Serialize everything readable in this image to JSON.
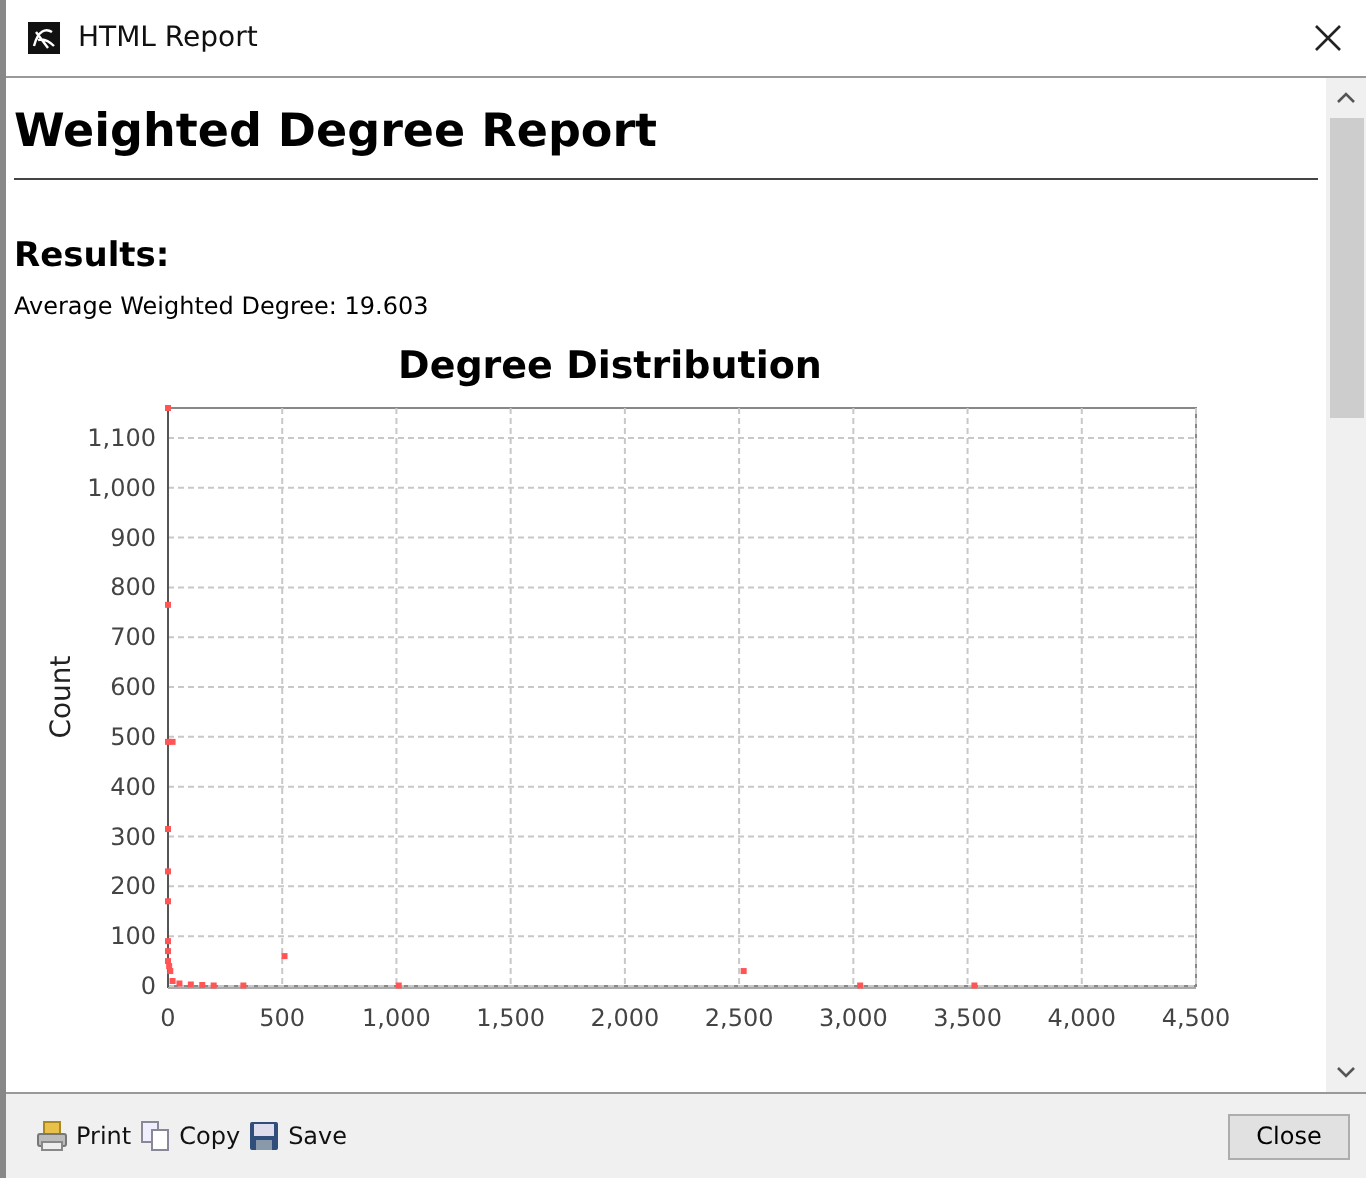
{
  "window": {
    "title": "HTML Report"
  },
  "report": {
    "heading": "Weighted Degree Report",
    "section": "Results:",
    "summary": "Average Weighted Degree: 19.603"
  },
  "chart_data": {
    "type": "scatter",
    "title": "Degree Distribution",
    "ylabel": "Count",
    "xlim": [
      0,
      4500
    ],
    "ylim": [
      0,
      1160
    ],
    "xticks": [
      {
        "value": 0,
        "label": "0"
      },
      {
        "value": 500,
        "label": "500"
      },
      {
        "value": 1000,
        "label": "1,000"
      },
      {
        "value": 1500,
        "label": "1,500"
      },
      {
        "value": 2000,
        "label": "2,000"
      },
      {
        "value": 2500,
        "label": "2,500"
      },
      {
        "value": 3000,
        "label": "3,000"
      },
      {
        "value": 3500,
        "label": "3,500"
      },
      {
        "value": 4000,
        "label": "4,000"
      },
      {
        "value": 4500,
        "label": "4,500"
      }
    ],
    "yticks": [
      {
        "value": 0,
        "label": "0"
      },
      {
        "value": 100,
        "label": "100"
      },
      {
        "value": 200,
        "label": "200"
      },
      {
        "value": 300,
        "label": "300"
      },
      {
        "value": 400,
        "label": "400"
      },
      {
        "value": 500,
        "label": "500"
      },
      {
        "value": 600,
        "label": "600"
      },
      {
        "value": 700,
        "label": "700"
      },
      {
        "value": 800,
        "label": "800"
      },
      {
        "value": 900,
        "label": "900"
      },
      {
        "value": 1000,
        "label": "1,000"
      },
      {
        "value": 1100,
        "label": "1,100"
      }
    ],
    "grid": true,
    "series": [
      {
        "color": "#ff5555",
        "x": [
          0,
          0,
          0,
          20,
          0,
          0,
          0,
          0,
          0,
          0,
          5,
          10,
          20,
          50,
          100,
          150,
          200,
          330,
          510,
          1010,
          2520,
          3030,
          3530
        ],
        "values": [
          1160,
          765,
          490,
          490,
          315,
          230,
          170,
          90,
          70,
          50,
          40,
          30,
          10,
          5,
          3,
          2,
          1,
          1,
          60,
          1,
          30,
          1,
          1
        ]
      }
    ]
  },
  "toolbar": [
    "Print",
    "Copy",
    "Save"
  ],
  "close_button": "Close"
}
